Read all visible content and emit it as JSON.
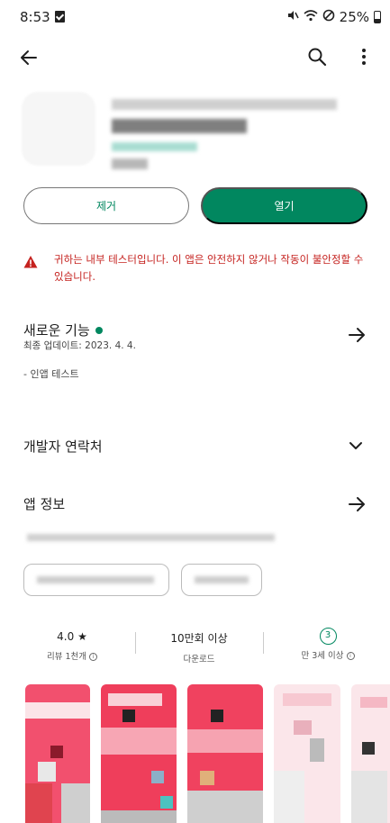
{
  "status_bar": {
    "time": "8:53",
    "battery": "25%"
  },
  "actions": {
    "remove_label": "제거",
    "open_label": "열기"
  },
  "warning": {
    "text": "귀하는 내부 테스터입니다. 이 앱은 안전하지 않거나 작동이 불안정할 수 있습니다."
  },
  "whats_new": {
    "title": "새로운 기능",
    "last_updated": "최종 업데이트: 2023. 4. 4.",
    "notes": "- 인앱 테스트"
  },
  "developer_contact": {
    "title": "개발자 연락처"
  },
  "app_info": {
    "title": "앱 정보"
  },
  "stats": {
    "rating": "4.0",
    "rating_star": "★",
    "reviews_label": "리뷰 1천개",
    "downloads": "10만회 이상",
    "downloads_label": "다운로드",
    "age_badge": "3",
    "age_label": "만 3세 이상"
  },
  "colors": {
    "accent": "#01875f",
    "warning": "#c5221f"
  }
}
